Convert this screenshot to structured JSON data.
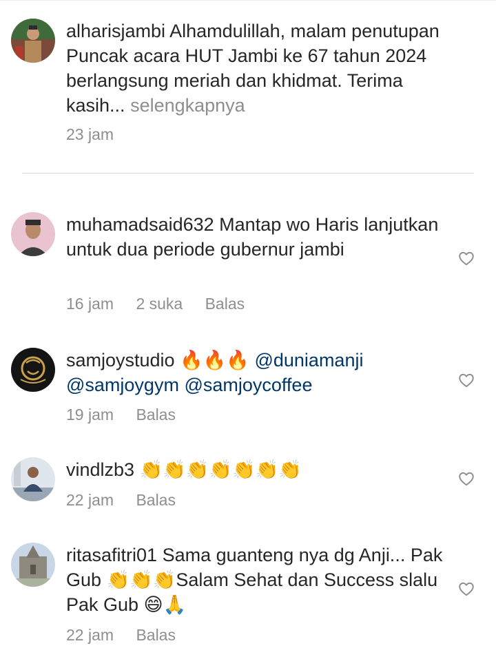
{
  "caption": {
    "username": "alharisjambi",
    "text": "Alhamdulillah, malam penutupan Puncak acara HUT Jambi ke 67 tahun 2024 berlangsung meriah dan khidmat. Terima kasih...",
    "more_label": "selengkapnya",
    "time": "23 jam"
  },
  "comments": [
    {
      "username": "muhamadsaid632",
      "text": "Mantap wo Haris lanjutkan untuk dua periode gubernur jambi",
      "time": "16 jam",
      "likes": "2 suka",
      "reply_label": "Balas"
    },
    {
      "username": "samjoystudio",
      "text": "🔥🔥🔥",
      "mention1": "@duniamanji",
      "mention2": "@samjoygym",
      "mention3": "@samjoycoffee",
      "time": "19 jam",
      "reply_label": "Balas"
    },
    {
      "username": "vindlzb3",
      "text": "👏👏👏👏👏👏👏",
      "time": "22 jam",
      "reply_label": "Balas"
    },
    {
      "username": "ritasafitri01",
      "text": "Sama guanteng nya dg Anji... Pak Gub 👏👏👏Salam Sehat dan Success slalu Pak Gub 😄🙏",
      "time": "22 jam",
      "reply_label": "Balas"
    }
  ],
  "icons": {
    "like": "heart-outline-icon"
  },
  "colors": {
    "text": "#262626",
    "secondary": "#8e8e8e",
    "mention": "#00376b"
  }
}
